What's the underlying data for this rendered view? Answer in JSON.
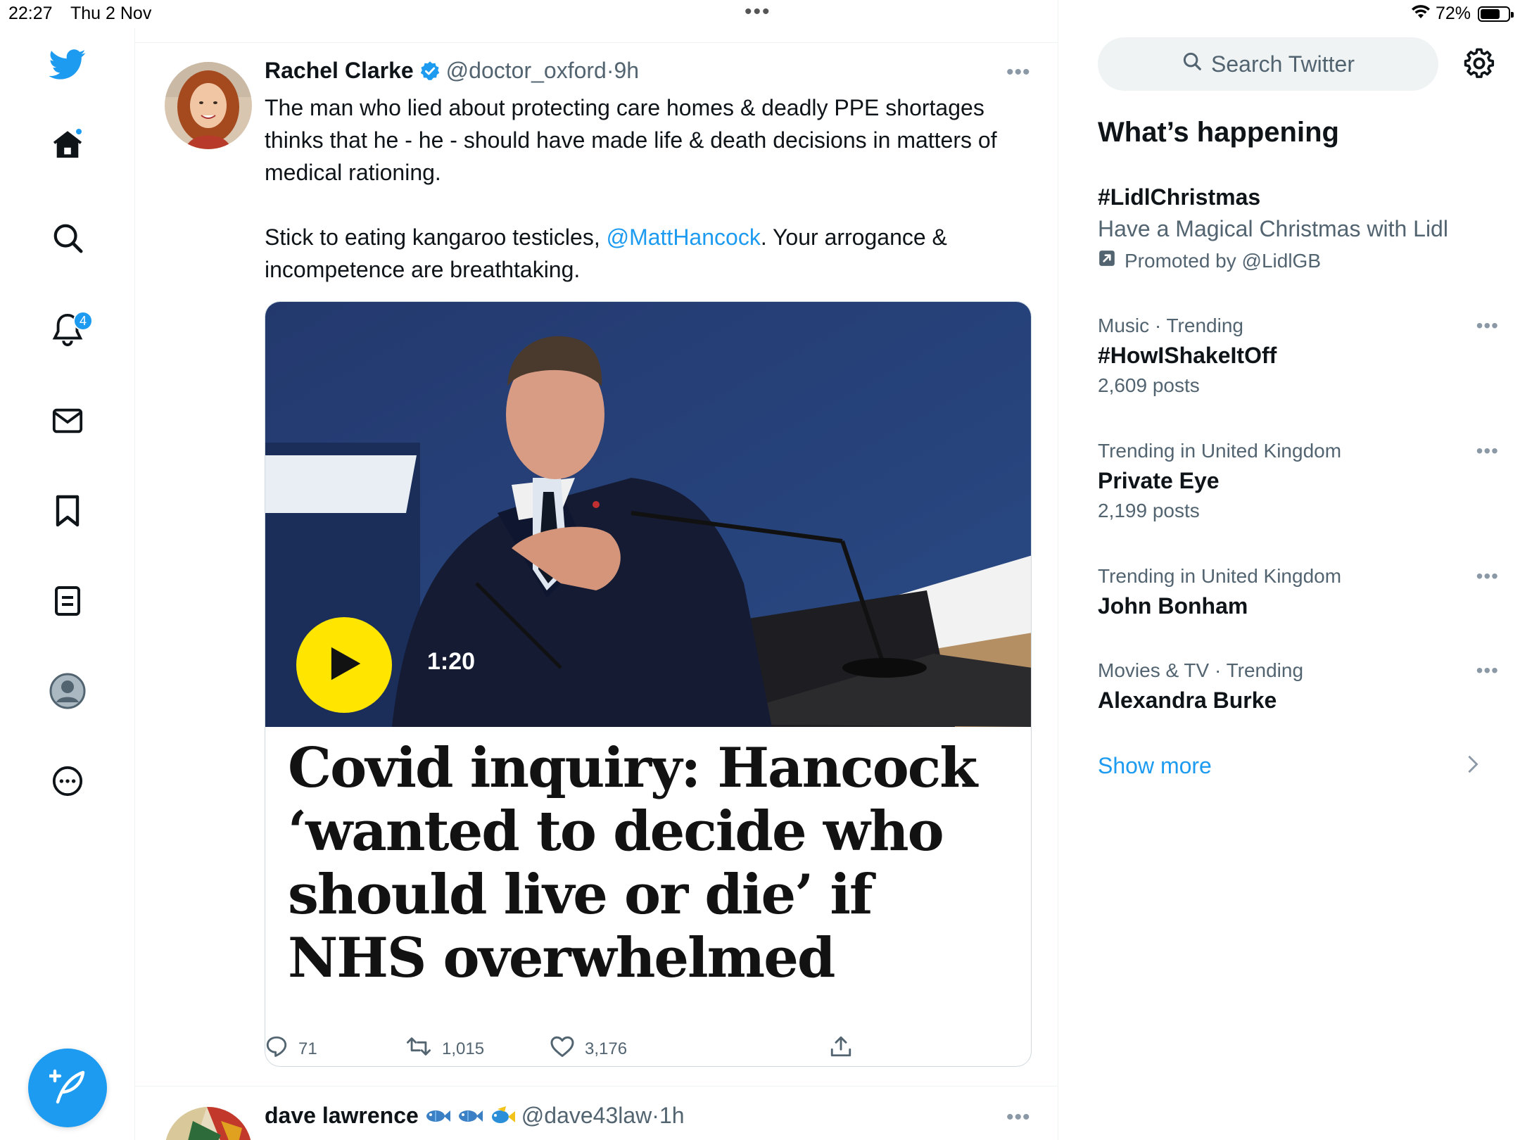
{
  "status_bar": {
    "time": "22:27",
    "date": "Thu 2 Nov",
    "multitask_dots": "•••",
    "battery_percent": "72%",
    "battery_level": 0.72
  },
  "nav": {
    "items": [
      {
        "name": "twitter-logo",
        "icon": "bird-icon"
      },
      {
        "name": "home",
        "icon": "home-icon"
      },
      {
        "name": "explore",
        "icon": "search-icon"
      },
      {
        "name": "notifications",
        "icon": "bell-icon",
        "badge": "4"
      },
      {
        "name": "messages",
        "icon": "mail-icon"
      },
      {
        "name": "bookmarks",
        "icon": "bookmark-icon"
      },
      {
        "name": "lists",
        "icon": "list-icon"
      },
      {
        "name": "profile",
        "icon": "profile-icon"
      },
      {
        "name": "more",
        "icon": "more-icon"
      }
    ],
    "compose_icon": "compose-icon"
  },
  "tweet": {
    "author_name": "Rachel Clarke",
    "handle": "@doctor_oxford",
    "separator": "·",
    "time": "9h",
    "more": "•••",
    "body_p1": "The man who lied about protecting care homes & deadly PPE shortages thinks that he - he - should have made life & death decisions in matters of medical rationing.",
    "body_p2_pre": "Stick to eating kangaroo testicles, ",
    "body_p2_mention": "@MattHancock",
    "body_p2_post": ". Your arrogance & incompetence are breathtaking.",
    "card": {
      "video_duration": "1:20",
      "headline": "Covid inquiry: Hancock ‘wanted to decide who should live or die’ if NHS overwhelmed"
    },
    "actions": {
      "replies": "71",
      "retweets": "1,015",
      "likes": "3,176"
    }
  },
  "tweet2": {
    "author_name": "dave lawrence",
    "handle": "@dave43law",
    "separator": "·",
    "time": "1h",
    "more": "•••"
  },
  "sidebar": {
    "search_placeholder": "Search Twitter",
    "whats_happening": "What’s happening",
    "trends": [
      {
        "topic": "#LidlChristmas",
        "desc": "Have a Magical Christmas with Lidl",
        "promo": "Promoted by @LidlGB"
      },
      {
        "context": "Music · Trending",
        "topic": "#HowIShakeItOff",
        "posts": "2,609 posts"
      },
      {
        "context": "Trending in United Kingdom",
        "topic": "Private Eye",
        "posts": "2,199 posts"
      },
      {
        "context": "Trending in United Kingdom",
        "topic": "John Bonham"
      },
      {
        "context": "Movies & TV · Trending",
        "topic": "Alexandra Burke"
      }
    ],
    "show_more": "Show more",
    "more_dots": "•••"
  },
  "colors": {
    "accent": "#1d9bf0",
    "text": "#0f1419",
    "secondary": "#536471",
    "play_button": "#ffe500"
  }
}
